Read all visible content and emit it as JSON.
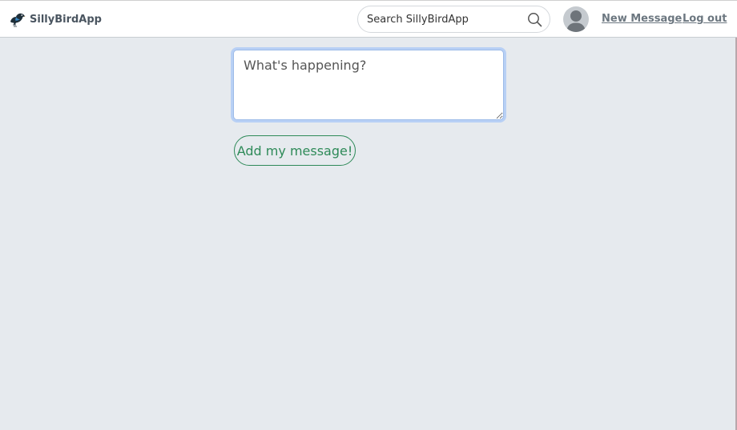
{
  "navbar": {
    "brand": {
      "logo_icon": "bird-logo-icon",
      "name": "SillyBirdApp"
    },
    "search": {
      "placeholder": "Search SillyBirdApp",
      "icon": "search-icon"
    },
    "avatar_icon": "user-avatar-icon",
    "links": {
      "new_message": "New Message",
      "log_out": "Log out"
    }
  },
  "composer": {
    "textarea_placeholder": "What's happening?",
    "submit_label": "Add my message!"
  },
  "colors": {
    "page_background": "#e6eaee",
    "navbar_background": "#ffffff",
    "nav_link": "#6c7780",
    "submit_accent": "#2e8a58",
    "focus_ring": "#b8d0f5"
  }
}
